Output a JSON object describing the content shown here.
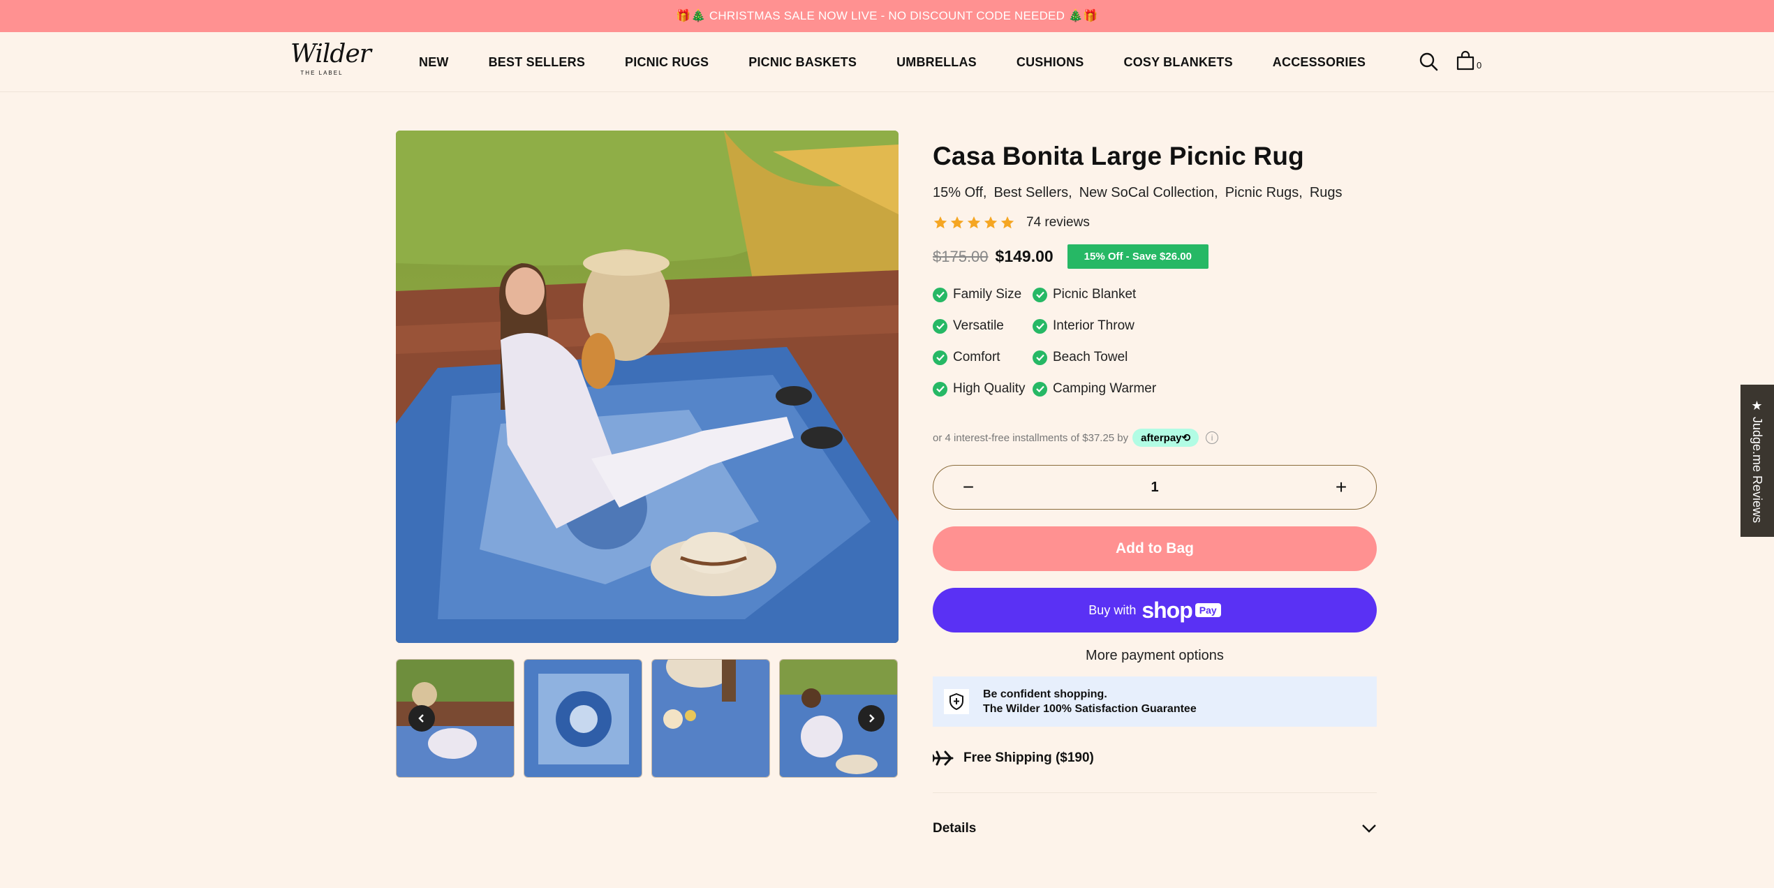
{
  "announcement": "🎁🎄 CHRISTMAS SALE NOW LIVE - NO DISCOUNT CODE NEEDED 🎄🎁",
  "logo": {
    "script": "Wilder",
    "sub": "THE LABEL"
  },
  "nav": [
    "NEW",
    "BEST SELLERS",
    "PICNIC RUGS",
    "PICNIC BASKETS",
    "UMBRELLAS",
    "CUSHIONS",
    "COSY BLANKETS",
    "ACCESSORIES"
  ],
  "cart": {
    "count": "0"
  },
  "product": {
    "title": "Casa Bonita Large Picnic Rug",
    "tags": [
      "15% Off,",
      "Best Sellers,",
      "New SoCal Collection,",
      "Picnic Rugs,",
      "Rugs"
    ],
    "rating": 5,
    "reviews": "74 reviews",
    "old_price": "$175.00",
    "price": "$149.00",
    "save_badge": "15% Off - Save $26.00",
    "features": [
      "Family Size",
      "Picnic Blanket",
      "Versatile",
      "Interior Throw",
      "Comfort",
      "Beach Towel",
      "High Quality",
      "Camping Warmer"
    ],
    "afterpay_text": "or 4 interest-free installments of $37.25 by",
    "afterpay_brand": "afterpay⟲",
    "quantity": "1",
    "add_to_bag": "Add to Bag",
    "buy_with": "Buy with",
    "shop_brand": "shop",
    "pay_label": "Pay",
    "more_payment": "More payment options",
    "guarantee_line1": "Be confident shopping.",
    "guarantee_line2": "The Wilder 100% Satisfaction Guarantee",
    "shipping": "Free Shipping ($190)",
    "details": "Details"
  },
  "judgeme": "★ Judge.me Reviews",
  "colors": {
    "accent": "#ff9191",
    "green": "#26b865",
    "shoppay": "#5a31f4",
    "background": "#fdf3ea"
  }
}
